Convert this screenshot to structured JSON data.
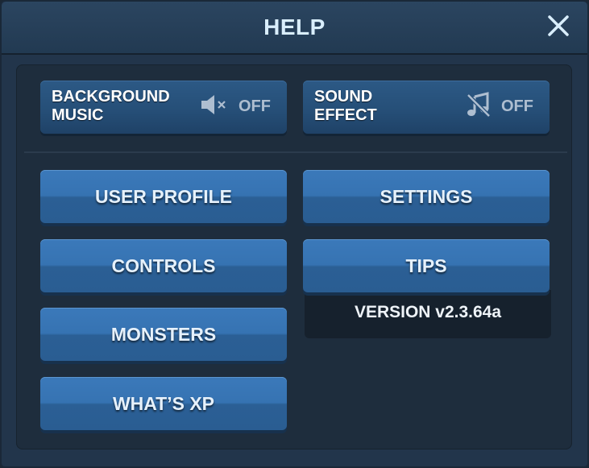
{
  "dialog": {
    "title": "HELP",
    "close_icon": "close-icon"
  },
  "toggles": {
    "background_music": {
      "label_line1": "BACKGROUND",
      "label_line2": "MUSIC",
      "state": "OFF",
      "icon": "speaker-muted-icon"
    },
    "sound_effect": {
      "label_line1": "SOUND",
      "label_line2": "EFFECT",
      "state": "OFF",
      "icon": "music-note-muted-icon"
    }
  },
  "menu": {
    "user_profile": "USER PROFILE",
    "settings": "SETTINGS",
    "controls": "CONTROLS",
    "tips": "TIPS",
    "monsters": "MONSTERS",
    "whats_xp": "WHAT’S XP"
  },
  "version": "VERSION v2.3.64a",
  "colors": {
    "button_blue": "#3673b2",
    "toggle_blue": "#264f78",
    "panel_bg": "#1e2d3d",
    "title_text": "#d9eefc"
  }
}
